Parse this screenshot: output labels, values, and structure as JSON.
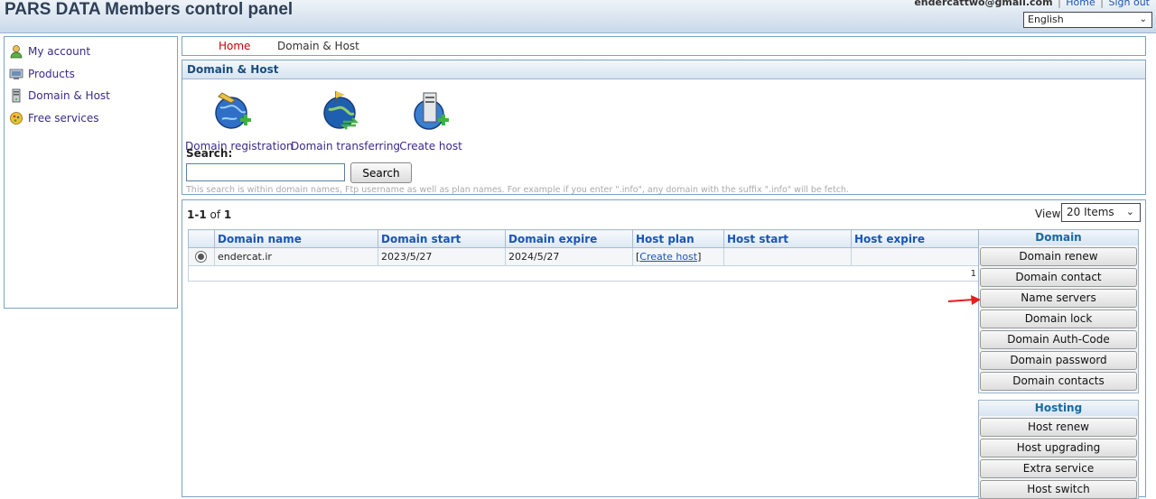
{
  "header": {
    "title": "PARS DATA Members control panel",
    "email": "endercattwo@gmail.com",
    "home_link": "Home",
    "signout_link": "Sign out",
    "language": "English"
  },
  "sidebar": {
    "items": [
      {
        "label": "My account",
        "icon": "user-icon"
      },
      {
        "label": "Products",
        "icon": "products-icon"
      },
      {
        "label": "Domain & Host",
        "icon": "server-icon"
      },
      {
        "label": "Free services",
        "icon": "gift-icon"
      }
    ]
  },
  "breadcrumb": {
    "home": "Home",
    "current": "Domain & Host"
  },
  "panel": {
    "title": "Domain & Host",
    "actions": [
      {
        "label": "Domain registration",
        "icon": "globe-add-icon"
      },
      {
        "label": "Domain transferring",
        "icon": "globe-transfer-icon"
      },
      {
        "label": "Create host",
        "icon": "server-add-icon"
      }
    ],
    "search_label": "Search:",
    "search_value": "",
    "search_button": "Search",
    "search_hint": "This search is within domain names, Ftp username as well as plan names. For example if you enter \".info\", any domain with the suffix \".info\" will be fetch."
  },
  "results": {
    "range": "1-1",
    "of_label": "of",
    "total": "1",
    "view_label": "View",
    "view_value": "20 Items",
    "columns": [
      "Domain name",
      "Domain start",
      "Domain expire",
      "Host plan",
      "Host start",
      "Host expire"
    ],
    "rows": [
      {
        "domain": "endercat.ir",
        "start": "2023/5/27",
        "expire": "2024/5/27",
        "host_plan_link": "Create host",
        "host_start": "",
        "host_expire": ""
      }
    ],
    "page": "1"
  },
  "domain_panel": {
    "title": "Domain",
    "buttons": [
      "Domain renew",
      "Domain contact",
      "Name servers",
      "Domain lock",
      "Domain Auth-Code",
      "Domain password",
      "Domain contacts"
    ]
  },
  "hosting_panel": {
    "title": "Hosting",
    "buttons": [
      "Host renew",
      "Host upgrading",
      "Extra service",
      "Host switch"
    ]
  },
  "colors": {
    "link": "#1a55b5",
    "sidebar_link": "#3b2a8a",
    "breadcrumb_home": "#cc0000",
    "arrow": "#e02020"
  }
}
